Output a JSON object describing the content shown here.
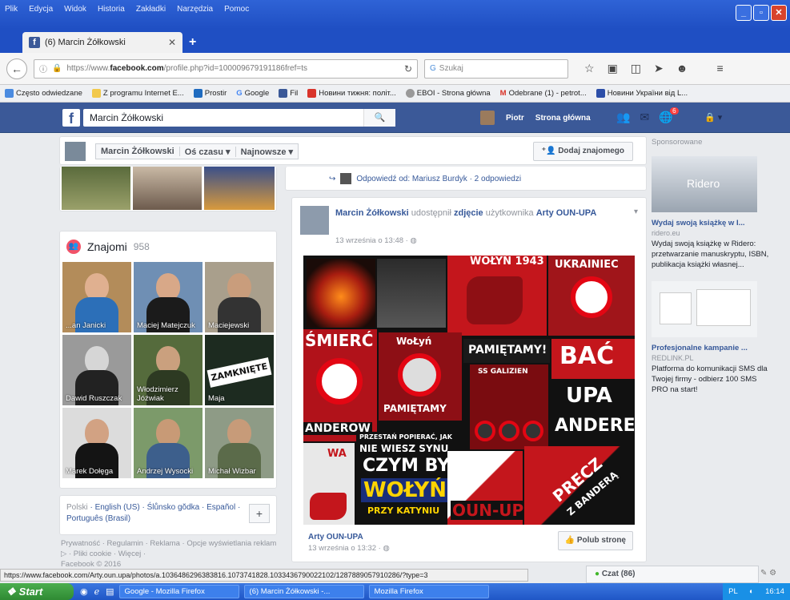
{
  "browser": {
    "menu": [
      "Plik",
      "Edycja",
      "Widok",
      "Historia",
      "Zakładki",
      "Narzędzia",
      "Pomoc"
    ],
    "tab_title": "(6) Marcin Żółkowski",
    "url_prefix": "https://www.",
    "url_domain": "facebook.com",
    "url_rest": "/profile.php?id=100009679191186fref=ts",
    "search_placeholder": "Szukaj",
    "bookmarks": [
      "Często odwiedzane",
      "Z programu Internet E...",
      "Prostir",
      "Google",
      "Fil",
      "Новини тижня: політ...",
      "EBOI - Strona główna",
      "Odebrane (1) - petrot...",
      "Новини України від L..."
    ]
  },
  "facebook": {
    "search_value": "Marcin Żółkowski",
    "user_name": "Piotr",
    "home_label": "Strona główna",
    "notifications_count": "6",
    "timeline": {
      "name": "Marcin Żółkowski",
      "filter1": "Oś czasu ▾",
      "filter2": "Najnowsze ▾",
      "add_friend": "Dodaj znajomego"
    },
    "friends": {
      "title": "Znajomi",
      "count": "958",
      "items": [
        {
          "name": "...an Janicki"
        },
        {
          "name": "Maciej Matejczuk"
        },
        {
          "name": "Maciejewski"
        },
        {
          "name": "Dawid Ruszczak"
        },
        {
          "name": "Włodzimierz Jóźwiak"
        },
        {
          "name": "Maja"
        },
        {
          "name": "Marek Dołęga"
        },
        {
          "name": "Andrzej Wysocki"
        },
        {
          "name": "Michał Wizbar"
        }
      ]
    },
    "languages": {
      "current": "Polski",
      "others": "· English (US) · Ślůnsko gŏdka · Español · Português (Brasil)"
    },
    "footer_links": "Prywatność · Regulamin · Reklama · Opcje wyświetlania reklam ▷ · Pliki cookie · Więcej ·",
    "footer_copy": "Facebook © 2016",
    "reply_text": "Odpowiedź od: Mariusz Burdyk · 2 odpowiedzi",
    "post": {
      "author": "Marcin Żółkowski",
      "shared": " udostępnił ",
      "photo_word": "zdjęcie",
      "of_user": " użytkownika ",
      "page": "Arty OUN-UPA",
      "time": "13 września o 13:48 · ◍",
      "collage_texts": {
        "wolyn1943": "WOŁYŃ 1943",
        "ukrainiec": "UKRAINIEC",
        "smierc": "ŚMIERĆ",
        "wolyn_small": "WoŁyń",
        "pamietamy1": "PAMIĘTAMY!",
        "bac": "BAĆ",
        "ss_galizien": "SS GALIZIEN",
        "pamietamy2": "PAMIĘTAMY",
        "upa": "UPA",
        "anderow": "ANDEROW",
        "andere": "ANDERE",
        "przestan": "PRZESTAŃ POPIERAĆ, JAK",
        "nie_wiesz": "NIE WIESZ SYNU",
        "czym_byl": "CZYM BYŁ",
        "wolyn_big": "WOŁYŃ",
        "przy_katyniu": "PRZY KATYNIU",
        "precz": "PRECZ",
        "z_bandera": "Z BANDERĄ",
        "oun_up": "OUN-UP",
        "wa": "WA"
      },
      "shared_page": "Arty OUN-UPA",
      "shared_time": "13 września o 13:32 · ◍",
      "like_page": "Polub stronę"
    },
    "sponsored": {
      "title": "Sponsorowane",
      "ads": [
        {
          "img_label": "Ridero",
          "head": "Wydaj swoją książkę w I...",
          "domain": "ridero.eu",
          "body": "Wydaj swoją książkę w Ridero: przetwarzanie manuskryptu, ISBN, publikacja książki własnej..."
        },
        {
          "img_label": "",
          "head": "Profesjonalne kampanie ...",
          "domain": "REDLINK.PL",
          "body": "Platforma do komunikacji SMS dla Twojej firmy - odbierz 100 SMS PRO na start!"
        }
      ]
    },
    "chat_label": "Czat (86)"
  },
  "statusbar_url": "https://www.facebook.com/Arty.oun.upa/photos/a.1036486296383816.1073741828.1033436790022102/1287889057910286/?type=3",
  "taskbar": {
    "start": "Start",
    "tasks": [
      "Google - Mozilla Firefox",
      "(6) Marcin Żółkowski -...",
      "Mozilla Firefox"
    ],
    "lang": "PL",
    "clock": "16:14"
  },
  "colors": {
    "fb_blue": "#3b5998",
    "link_blue": "#365899",
    "xp_blue": "#245edb",
    "poster_red": "#c4161c"
  }
}
